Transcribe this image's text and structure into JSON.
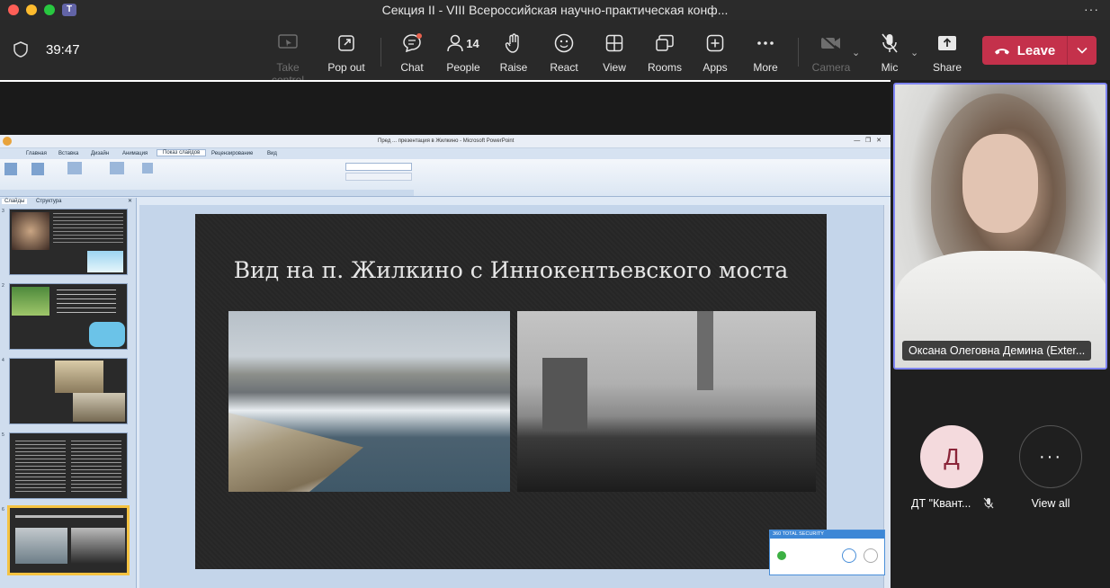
{
  "window": {
    "title": "Секция II - VIII Всероссийская научно-практическая конф..."
  },
  "toolbar": {
    "timer": "39:47",
    "take_control": "Take control",
    "pop_out": "Pop out",
    "chat": "Chat",
    "people": "People",
    "people_count": "14",
    "raise": "Raise",
    "react": "React",
    "view": "View",
    "rooms": "Rooms",
    "apps": "Apps",
    "more": "More",
    "camera": "Camera",
    "mic": "Mic",
    "share": "Share",
    "leave": "Leave"
  },
  "ppt": {
    "title": "Пред ... презентация в Жилкино - Microsoft PowerPoint",
    "tabs": [
      "Главная",
      "Вставка",
      "Дизайн",
      "Анимация",
      "Показ слайдов",
      "Рецензирование",
      "Вид"
    ],
    "active_tab": "Показ слайдов",
    "panel_tabs": [
      "Слайды",
      "Структура"
    ],
    "slide_numbers": [
      "3",
      "2",
      "4",
      "5",
      "6"
    ],
    "slide_title": "Вид на п. Жилкино с Иннокентьевского моста",
    "security_title": "360 TOTAL SECURITY"
  },
  "participants": {
    "main_video_name": "Оксана Олеговна Демина (Exter...",
    "p1_initial": "Д",
    "p1_name": "ДТ \"Квант...",
    "view_all": "View all"
  },
  "colors": {
    "leave": "#c4314b",
    "active_border": "#7f85f5",
    "accent": "#6264a7"
  }
}
